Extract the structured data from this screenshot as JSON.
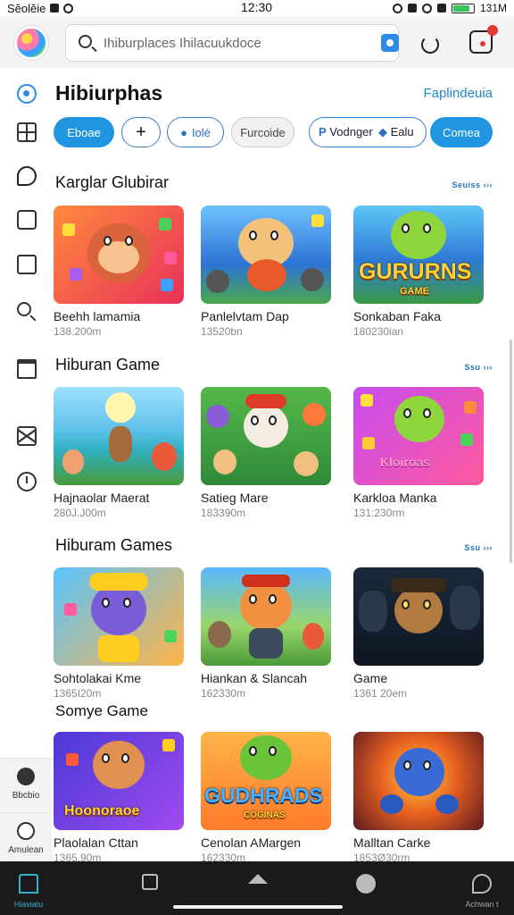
{
  "status_bar": {
    "left_text": "Sĕolĕie",
    "time": "12:30",
    "right_text": "131M"
  },
  "topbar": {
    "search_placeholder": "Ihiburplaces Ihilacuukdoce"
  },
  "sidebar": {
    "bottom_items": [
      {
        "label": "Bbcbio"
      },
      {
        "label": "Amulean"
      }
    ]
  },
  "header": {
    "title": "Hibiurphas",
    "link": "Faplindeuia"
  },
  "chips": [
    {
      "label": "Eboae",
      "style": "filled"
    },
    {
      "label": "+",
      "style": "outline"
    },
    {
      "label": "Iolé",
      "style": "outline"
    },
    {
      "label": "Furcoide",
      "style": "gray"
    },
    {
      "label": "Vodnger",
      "style": "group"
    },
    {
      "label": "Ealu",
      "style": "group"
    },
    {
      "label": "Comea",
      "style": "filled"
    }
  ],
  "sections": [
    {
      "title": "Karglar Glubirar",
      "see_more": "Seuiss ›››",
      "cards": [
        {
          "title": "Beehh lamamia",
          "meta": "138.200m"
        },
        {
          "title": "Panlelvtam Dap",
          "meta": "13520bn"
        },
        {
          "title": "Sonkaban Faka",
          "meta": "180230ian",
          "art_text": "GURURNS",
          "art_sub": "GAME"
        }
      ]
    },
    {
      "title": "Hiburan Game",
      "see_more": "Ssu ›››",
      "cards": [
        {
          "title": "Hajnaolar Maerat",
          "meta": "280J.J00m"
        },
        {
          "title": "Satieg Mare",
          "meta": "183390m"
        },
        {
          "title": "Karkloa Manka",
          "meta": "131:230rm",
          "art_text": "Kloiroas"
        }
      ]
    },
    {
      "title": "Hiburam Games",
      "see_more": "Ssu ›››",
      "cards": [
        {
          "title": "Sohtolakai Kme",
          "meta": "1365I20m"
        },
        {
          "title": "Hiankan & Slancah",
          "meta": "162330m"
        },
        {
          "title": "Game",
          "meta": "1361 20em"
        }
      ]
    },
    {
      "title": "Somye Game",
      "see_more": "",
      "cards": [
        {
          "title": "Plaolalan Cttan",
          "meta": "1365.90m",
          "art_text": "Hoonoraoe"
        },
        {
          "title": "Cenolan AMargen",
          "meta": "162330m",
          "art_text": "GUDHRADS",
          "art_sub": "COGINAS"
        },
        {
          "title": "Malltan Carke",
          "meta": "1853Ø30rm"
        }
      ]
    }
  ],
  "bottom_nav": [
    {
      "label": "Hiaviatu"
    },
    {
      "label": ""
    },
    {
      "label": ""
    },
    {
      "label": ""
    },
    {
      "label": "Achwan t"
    }
  ],
  "colors": {
    "accent": "#2196e0",
    "link": "#1e88c8",
    "nav_bg": "#1a1a1a",
    "topbar_bg": "#f3f3f5"
  }
}
